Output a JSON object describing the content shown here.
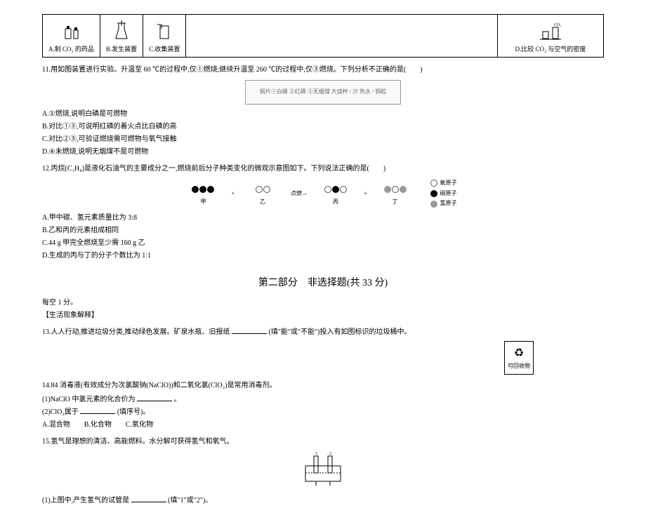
{
  "table": {
    "a": {
      "caption": "A.制 CO₂ 的药品"
    },
    "b": {
      "caption": "B.发生装置"
    },
    "c": {
      "caption": "C.收集装置"
    },
    "d": {
      "caption": "D.比较 CO₂ 与空气的密度"
    }
  },
  "q11": {
    "stem": "11.用如图装置进行实验。升温至 60 ℃的过程中,仅①燃烧;继续升温至 260 ℃的过程中,仅③燃烧。下列分析不正确的是(　　)",
    "diagram_labels": "铜片①白磷 ②红磷 ③无烟煤 大烧杯 / 沙 热水 / 铜粒",
    "A": "A.①燃烧,说明白磷是可燃物",
    "B": "B.对比①③,可说明红磷的着火点比白磷的高",
    "C": "C.对比②③,可验证燃烧需可燃物与氧气接触",
    "D": "D.④未燃烧,说明无烟煤不是可燃物"
  },
  "q12": {
    "stem": "12.丙烷(C₃H₈)是液化石油气的主要成分之一,燃烧前后分子种类变化的微观示意图如下。下列说法正确的是(　　)",
    "mol1": "甲",
    "mol2": "乙",
    "mol3": "丙",
    "mol4": "丁",
    "legend_o": "氧原子",
    "legend_c": "碳原子",
    "legend_h": "氢原子",
    "A": "A.甲中碳、氢元素质量比为 3:8",
    "B": "B.乙和丙的元素组成相同",
    "C": "C.44 g 甲完全燃烧至少需 160 g 乙",
    "D": "D.生成的丙与丁的分子个数比为 1:1"
  },
  "section2": {
    "title": "第二部分　非选择题(共 33 分)",
    "note": "每空 1 分。",
    "topic": "【生活现象解释】"
  },
  "q13": {
    "text_a": "13.人人行动,推进垃圾分类,推动绿色发展。矿泉水瓶、旧报纸",
    "text_b": "(填\"能\"或\"不能\")投入有如图标识的垃圾桶中。",
    "recycle": "可回收物"
  },
  "q14": {
    "stem": "14.84 消毒液(有效成分为次氯酸钠(NaClO))和二氧化氯(ClO₂)是常用消毒剂。",
    "p1a": "(1)NaClO 中氯元素的化合价为",
    "p1b": "。",
    "p2a": "(2)ClO₂属于",
    "p2b": "(填序号)。",
    "A": "A.混合物",
    "B": "B.化合物",
    "C": "C.氧化物"
  },
  "q15": {
    "stem": "15.氢气是理想的清洁、高能燃料。水分解可获得氢气和氧气。",
    "p1a": "(1)上图中,产生氢气的试管是",
    "p1b": "(填\"1\"或\"2\")。"
  }
}
